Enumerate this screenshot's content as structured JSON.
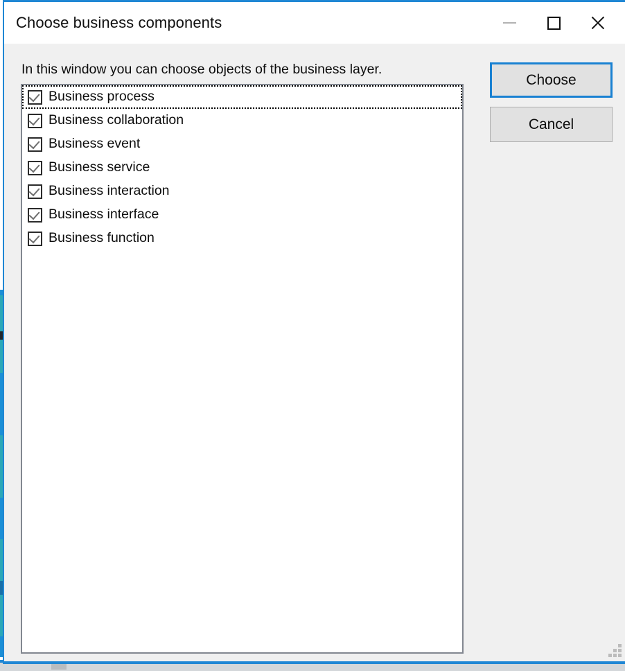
{
  "window": {
    "title": "Choose business components",
    "caption_buttons": [
      {
        "name": "minimize",
        "glyph": "minimize-icon",
        "enabled": false
      },
      {
        "name": "maximize",
        "glyph": "maximize-icon",
        "enabled": true
      },
      {
        "name": "close",
        "glyph": "close-icon",
        "enabled": true
      }
    ],
    "accent_color": "#2087d4",
    "titlebar_background": "#ffffff",
    "body_background": "#f0f0f0"
  },
  "content": {
    "instruction": "In this window you can choose objects of the business layer."
  },
  "listbox": {
    "background": "#ffffff",
    "border_color": "#828790",
    "items": [
      {
        "label": "Business process",
        "checked": true,
        "focused": true
      },
      {
        "label": "Business collaboration",
        "checked": true,
        "focused": false
      },
      {
        "label": "Business event",
        "checked": true,
        "focused": false
      },
      {
        "label": "Business service",
        "checked": true,
        "focused": false
      },
      {
        "label": "Business interaction",
        "checked": true,
        "focused": false
      },
      {
        "label": "Business interface",
        "checked": true,
        "focused": false
      },
      {
        "label": "Business function",
        "checked": true,
        "focused": false
      }
    ]
  },
  "buttons": {
    "choose": {
      "label": "Choose",
      "default": true,
      "border_color": "#1981d2"
    },
    "cancel": {
      "label": "Cancel",
      "default": false,
      "border_color": "#adadad"
    }
  },
  "decorations": {
    "resize_grip": "resize-grip-icon"
  }
}
